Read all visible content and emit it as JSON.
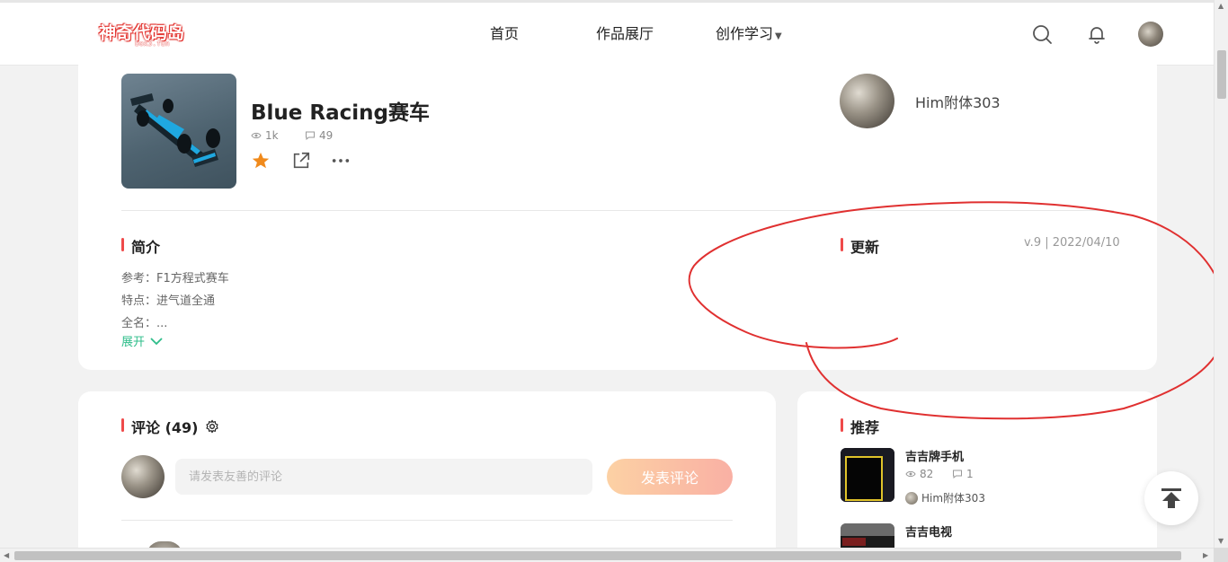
{
  "header": {
    "logo_text": "神奇代码岛",
    "logo_sub": "box3.fun",
    "nav": [
      {
        "label": "首页"
      },
      {
        "label": "作品展厅"
      },
      {
        "label": "创作学习"
      }
    ],
    "icons": [
      "search-icon",
      "bell-icon"
    ]
  },
  "project": {
    "title": "Blue Racing赛车",
    "views": "1k",
    "comments": "49",
    "actions": [
      "star-icon",
      "share-icon",
      "more-icon"
    ],
    "author": "Him附体303"
  },
  "intro": {
    "title": "简介",
    "lines": [
      "参考：F1方程式赛车",
      "特点：进气道全通",
      "全名：..."
    ],
    "expand_label": "展开"
  },
  "update": {
    "title": "更新",
    "version": "v.9 | 2022/04/10"
  },
  "comments_section": {
    "title": "评论 (49)",
    "placeholder": "请发表友善的评论",
    "post_label": "发表评论"
  },
  "recommend": {
    "title": "推荐",
    "items": [
      {
        "title": "吉吉牌手机",
        "views": "82",
        "comments": "1",
        "author": "Him附体303"
      },
      {
        "title": "吉吉电视"
      }
    ]
  },
  "colors": {
    "accent_red": "#ef4a4a",
    "expand_green": "#2ebd8a",
    "star_orange": "#f08a1c",
    "annotation_red": "#e03030"
  }
}
